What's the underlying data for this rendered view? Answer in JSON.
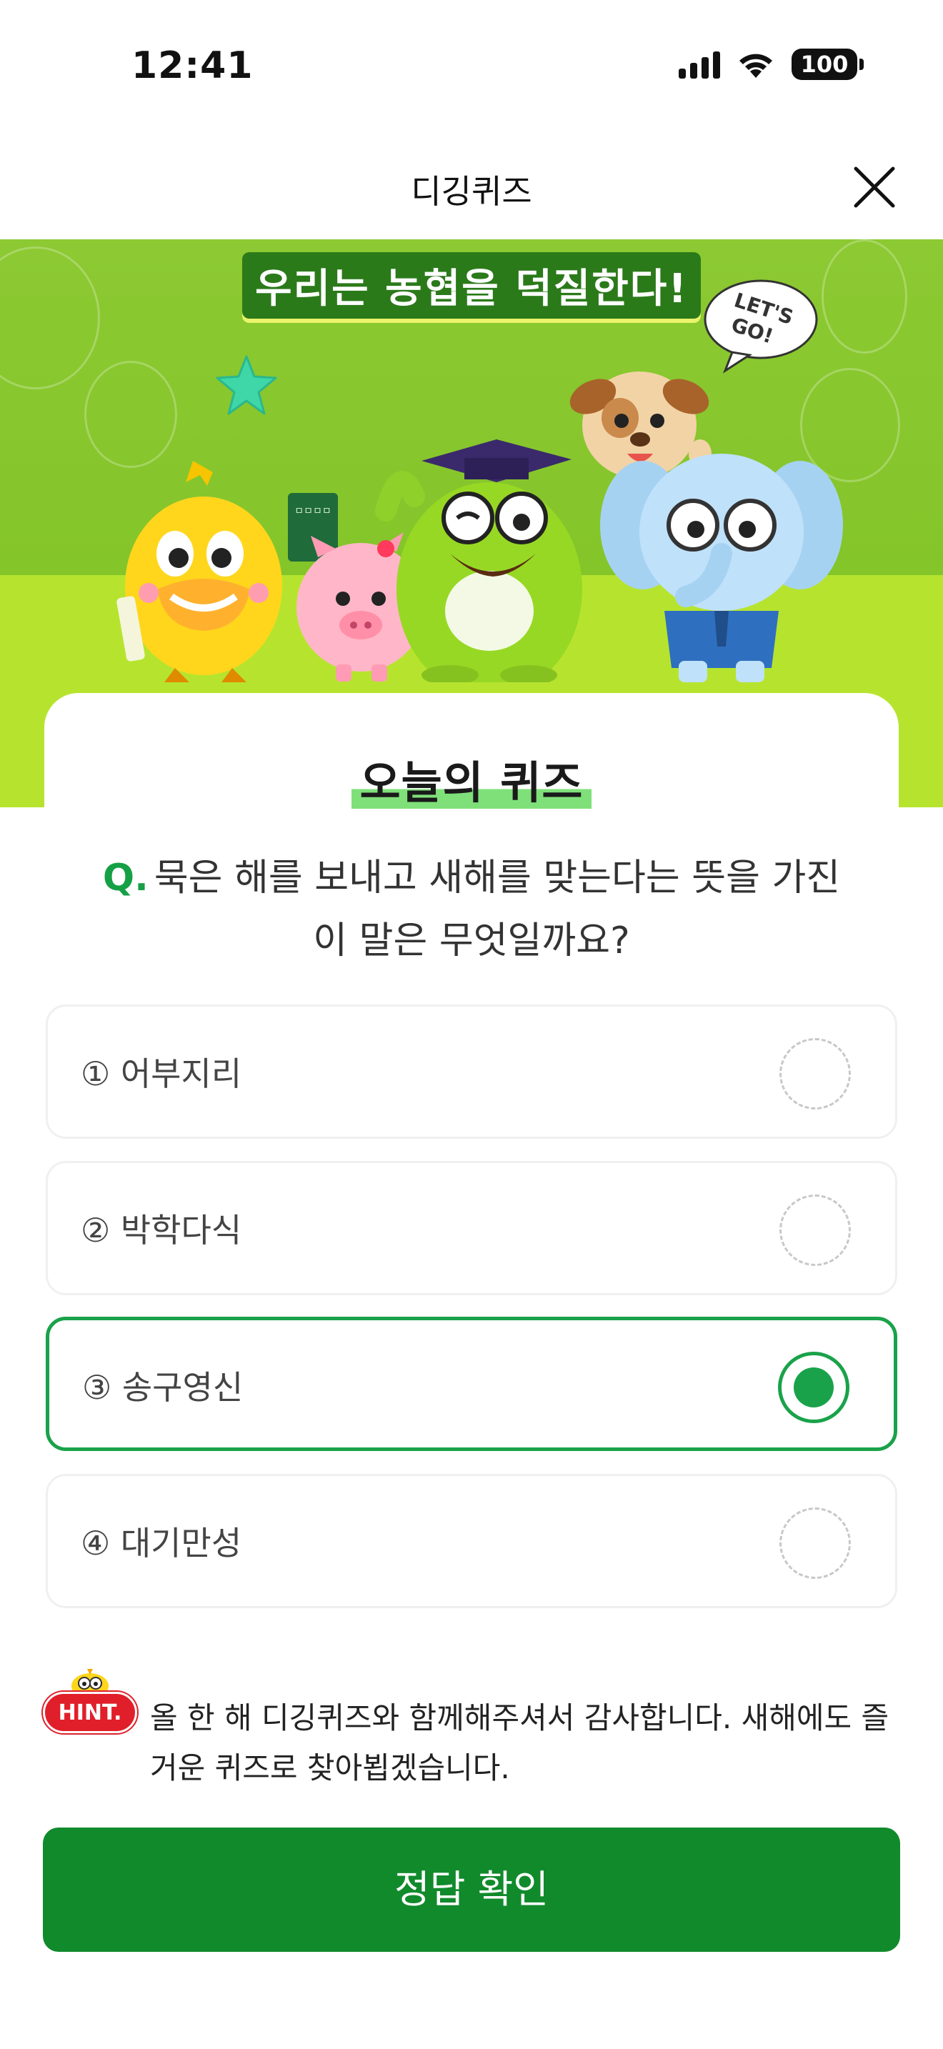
{
  "status_bar": {
    "time": "12:41",
    "battery": "100"
  },
  "header": {
    "title": "디깅퀴즈",
    "close_icon": "close-icon"
  },
  "banner": {
    "headline": "우리는 농협을 덕질한다!",
    "speech_bubble": "LET'S GO!",
    "book_label": "ㅁㅁㅁㅁ",
    "colors": {
      "sky": "#8cc932",
      "ground": "#b6e42e"
    }
  },
  "quiz": {
    "heading": "오늘의 퀴즈",
    "q_mark": "Q.",
    "question_line1": "묵은 해를 보내고 새해를 맞는다는 뜻을 가진",
    "question_line2": "이 말은 무엇일까요?",
    "options": [
      {
        "label": "① 어부지리",
        "selected": false
      },
      {
        "label": "② 박학다식",
        "selected": false
      },
      {
        "label": "③ 송구영신",
        "selected": true
      },
      {
        "label": "④ 대기만성",
        "selected": false
      }
    ]
  },
  "hint": {
    "badge": "HINT.",
    "text": "올 한 해 디깅퀴즈와 함께해주셔서 감사합니다. 새해에도 즐거운 퀴즈로 찾아뵙겠습니다."
  },
  "confirm_button": {
    "label": "정답 확인"
  },
  "colors": {
    "accent": "#1aa24a",
    "button": "#118a2c",
    "hint_badge": "#e01f2a"
  }
}
